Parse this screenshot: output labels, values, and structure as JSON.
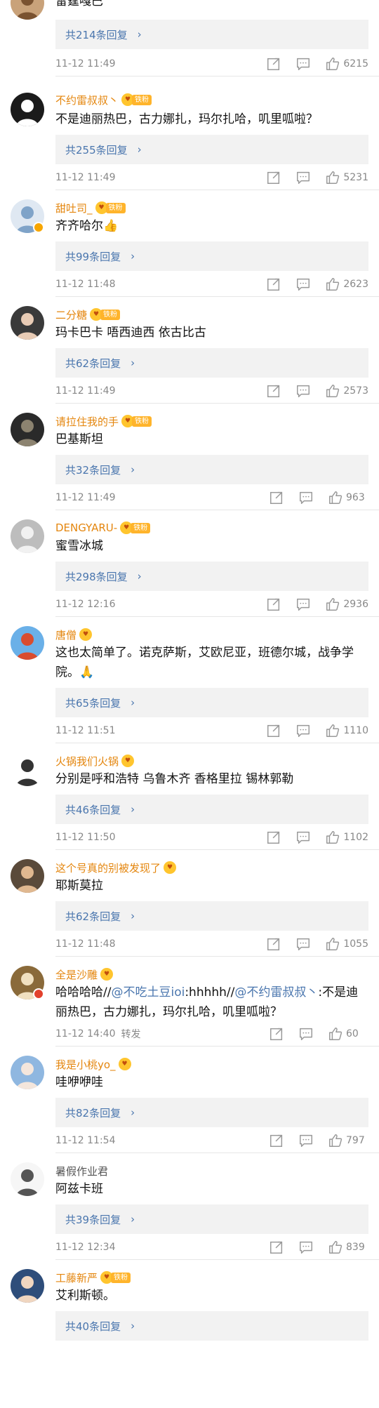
{
  "colors": {
    "username": "#e4860e",
    "link": "#4a76ae",
    "fan_badge": "#ffb42b",
    "meta_text": "#888888"
  },
  "fan_badge_label": "铁粉",
  "comments": [
    {
      "username": "",
      "text": "雷霆嘎巴",
      "replies": "共214条回复",
      "time": "11-12 11:49",
      "likes": "6215",
      "avatar_icon": "avatar-photo-icon",
      "fan_badge": false
    },
    {
      "username": "不约雷叔叔丶",
      "text": "不是迪丽热巴，古力娜扎，玛尔扎哈，叽里呱啦？",
      "replies": "共255条回复",
      "time": "11-12 11:49",
      "likes": "5231",
      "avatar_icon": "avatar-hat-icon",
      "fan_badge": true
    },
    {
      "username": "甜吐司_",
      "text": "齐齐哈尔👍",
      "replies": "共99条回复",
      "time": "11-12 11:48",
      "likes": "2623",
      "avatar_icon": "avatar-anime-icon",
      "fan_badge": true
    },
    {
      "username": "二分糖",
      "text": "玛卡巴卡 唔西迪西 依古比古",
      "replies": "共62条回复",
      "time": "11-12 11:49",
      "likes": "2573",
      "avatar_icon": "avatar-girl-icon",
      "fan_badge": true
    },
    {
      "username": "请拉住我的手",
      "text": "巴基斯坦",
      "replies": "共32条回复",
      "time": "11-12 11:49",
      "likes": "963",
      "avatar_icon": "avatar-dark-icon",
      "fan_badge": true
    },
    {
      "username": "DENGYARU-",
      "text": "蜜雪冰城",
      "replies": "共298条回复",
      "time": "11-12 12:16",
      "likes": "2936",
      "avatar_icon": "avatar-statue-icon",
      "fan_badge": true
    },
    {
      "username": "唐僧",
      "text": "这也太简单了。诺克萨斯，艾欧尼亚，班德尔城，战争学院。🙏",
      "replies": "共65条回复",
      "time": "11-12 11:51",
      "likes": "1110",
      "avatar_icon": "avatar-monk-icon",
      "fan_badge": false
    },
    {
      "username": "火锅我们火锅",
      "text": "分别是呼和浩特 乌鲁木齐 香格里拉 锡林郭勒",
      "replies": "共46条回复",
      "time": "11-12 11:50",
      "likes": "1102",
      "avatar_icon": "avatar-cartoon-icon",
      "fan_badge": false
    },
    {
      "username": "这个号真的别被发现了",
      "text": "耶斯莫拉",
      "replies": "共62条回复",
      "time": "11-12 11:48",
      "likes": "1055",
      "avatar_icon": "avatar-cap-icon",
      "fan_badge": false
    },
    {
      "username": "全是沙雕",
      "text_parts": [
        "哈哈哈哈//",
        "@不吃土豆ioi",
        ":hhhhh//",
        "@不约雷叔叔丶",
        ":不是迪丽热巴，古力娜扎，玛尔扎哈，叽里呱啦？"
      ],
      "replies": "",
      "time": "11-12 14:40",
      "retweet_label": "转发",
      "likes": "60",
      "avatar_icon": "avatar-dog-icon",
      "fan_badge": false
    },
    {
      "username": "我是小桃yo_",
      "text": "哇咿咿哇",
      "replies": "共82条回复",
      "time": "11-12 11:54",
      "likes": "797",
      "avatar_icon": "avatar-girl2-icon",
      "fan_badge": false
    },
    {
      "username": "暑假作业君",
      "text": "阿兹卡班",
      "replies": "共39条回复",
      "time": "11-12 12:34",
      "likes": "839",
      "avatar_icon": "avatar-sketch-icon",
      "fan_badge": false
    },
    {
      "username": "工藤新严",
      "text": "艾利斯顿。",
      "replies": "共40条回复",
      "time": "",
      "likes": "",
      "avatar_icon": "avatar-boy-icon",
      "fan_badge": true
    }
  ]
}
